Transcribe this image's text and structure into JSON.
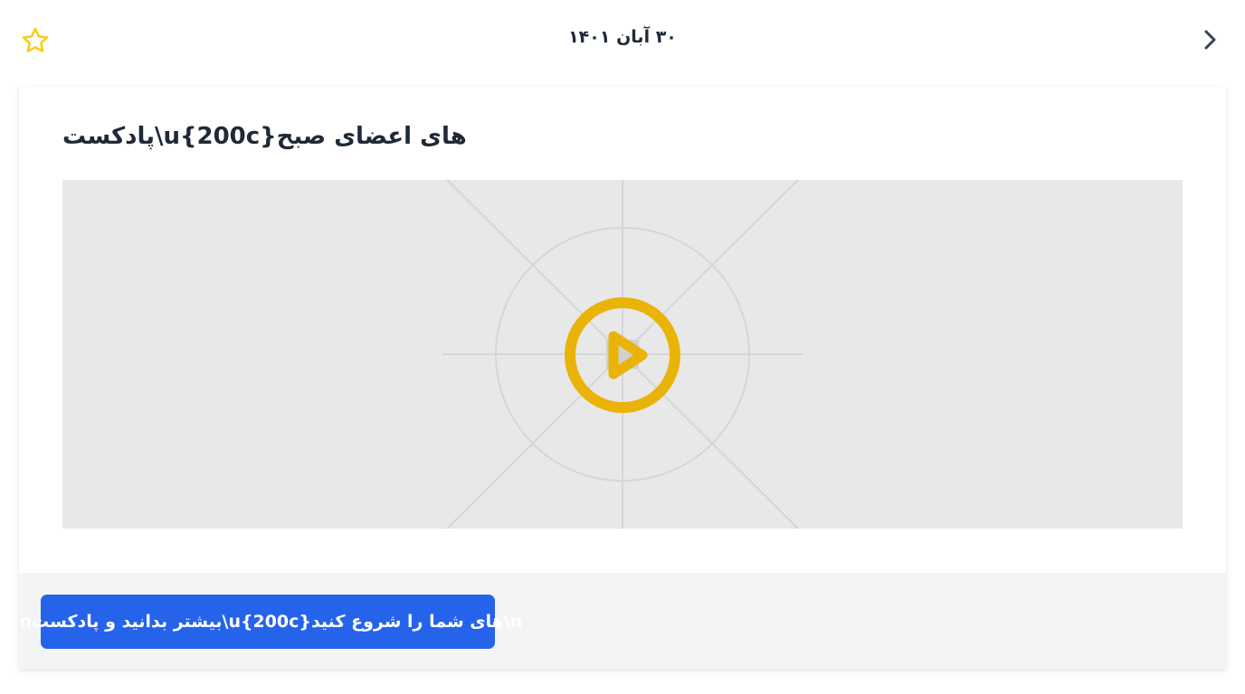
{
  "header": {
    "date": "۳۰ آبان ۱۴۰۱",
    "favorite_icon": "star-outline-icon",
    "back_icon": "chevron-right-icon"
  },
  "card": {
    "title": "پادکست\\u{200c}های اعضای صبح",
    "media": {
      "play_icon": "play-circle-icon"
    },
    "cta_label": "\\nبیشتر بدانید و پادکست\\u{200c}های شما را شروع کنید\\n"
  },
  "colors": {
    "accent": "#eab308",
    "star": "#facc15",
    "cta_bg": "#2563eb",
    "media_bg": "#e8e8e8",
    "footer_bg": "#f3f4f6",
    "text": "#1f2937"
  }
}
